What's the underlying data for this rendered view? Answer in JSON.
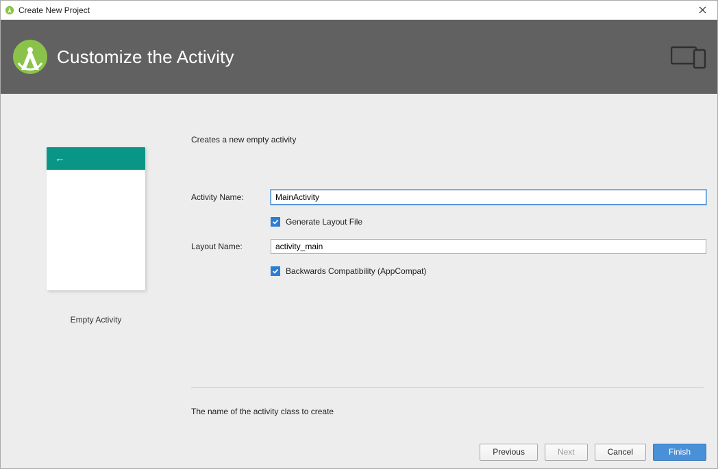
{
  "window": {
    "title": "Create New Project"
  },
  "banner": {
    "heading": "Customize the Activity"
  },
  "left": {
    "preview_caption": "Empty Activity"
  },
  "form": {
    "description": "Creates a new empty activity",
    "activity_name_label": "Activity Name:",
    "activity_name_value": "MainActivity",
    "generate_layout_label": "Generate Layout File",
    "layout_name_label": "Layout Name:",
    "layout_name_value": "activity_main",
    "backwards_compat_label": "Backwards Compatibility (AppCompat)",
    "hint": "The name of the activity class to create"
  },
  "buttons": {
    "previous": "Previous",
    "next": "Next",
    "cancel": "Cancel",
    "finish": "Finish"
  }
}
